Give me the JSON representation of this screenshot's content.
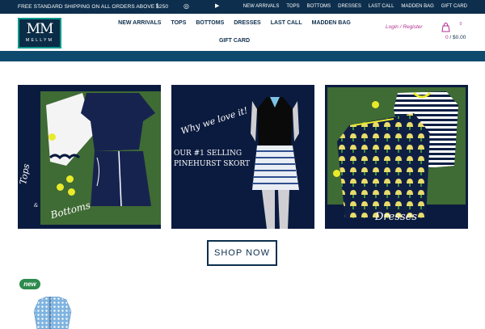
{
  "topbar": {
    "shipping": "FREE STANDARD SHIPPING ON ALL ORDERS ABOVE $250",
    "social": [
      {
        "icon": "facebook-icon",
        "glyph": "f"
      },
      {
        "icon": "instagram-icon",
        "glyph": "◎"
      },
      {
        "icon": "youtube-icon",
        "glyph": "▶"
      }
    ],
    "links": [
      "NEW ARRIVALS",
      "TOPS",
      "BOTTOMS",
      "DRESSES",
      "LAST CALL",
      "MADDEN BAG",
      "GIFT CARD"
    ]
  },
  "header": {
    "logo": {
      "mark": "MM",
      "name": "MELLYM"
    },
    "nav_row1": [
      "NEW ARRIVALS",
      "TOPS",
      "BOTTOMS",
      "DRESSES",
      "LAST CALL",
      "MADDEN BAG"
    ],
    "nav_row2": [
      "GIFT CARD"
    ],
    "login": "Login / Register",
    "cart": {
      "count": "0",
      "total_prefix": "0",
      "total": " / $0.00",
      "icon": "shopping-bag-icon"
    }
  },
  "colors": {
    "navy": "#0d2f4d",
    "accent": "#b03090",
    "teal": "#0a9a8c",
    "panel": "#0b1b3f",
    "new_badge": "#2e8b4e"
  },
  "panels": [
    {
      "name": "tops-and-bottoms",
      "caption1": "Tops",
      "amp": "&",
      "caption2": "Bottoms"
    },
    {
      "name": "pinehurst-skort",
      "headline": "Why we love it!",
      "line1": "OUR #1 SELLING",
      "line2": "PINEHURST SKORT"
    },
    {
      "name": "dresses",
      "caption": "Dresses"
    }
  ],
  "shop_button": "SHOP NOW",
  "new_badge": "new"
}
